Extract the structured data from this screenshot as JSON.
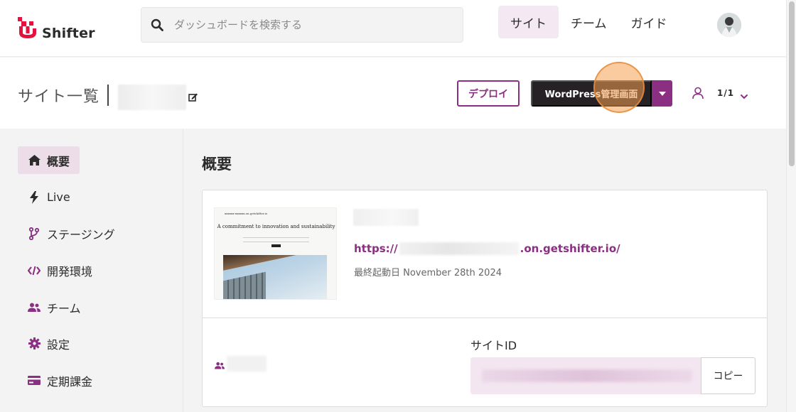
{
  "brand": {
    "name": "Shifter",
    "color": "#8a2f82"
  },
  "search": {
    "placeholder": "ダッシュボードを検索する"
  },
  "nav": [
    {
      "label": "サイト",
      "active": true
    },
    {
      "label": "チーム",
      "active": false
    },
    {
      "label": "ガイド",
      "active": false
    }
  ],
  "subheader": {
    "title": "サイト一覧",
    "deploy_label": "デプロイ",
    "wp_admin_label": "WordPress管理画面",
    "member_count": "1/1"
  },
  "sidebar": {
    "items": [
      {
        "label": "概要",
        "icon": "home-icon",
        "active": true
      },
      {
        "label": "Live",
        "icon": "bolt-icon",
        "active": false
      },
      {
        "label": "ステージング",
        "icon": "branch-icon",
        "active": false
      },
      {
        "label": "開発環境",
        "icon": "code-icon",
        "active": false
      },
      {
        "label": "チーム",
        "icon": "users-icon",
        "active": false
      },
      {
        "label": "設定",
        "icon": "gear-icon",
        "active": false
      },
      {
        "label": "定期課金",
        "icon": "credit-card-icon",
        "active": false
      }
    ]
  },
  "main": {
    "title": "概要",
    "thumbnail": {
      "header": "xxxxxx-xxxxxx.on.getshifter.io",
      "title": "A commitment to innovation and sustainability"
    },
    "site_url_prefix": "https://",
    "site_url_suffix": ".on.getshifter.io/",
    "last_launch": "最終起動日 November 28th 2024",
    "site_id_label": "サイトID",
    "copy_label": "コピー"
  }
}
